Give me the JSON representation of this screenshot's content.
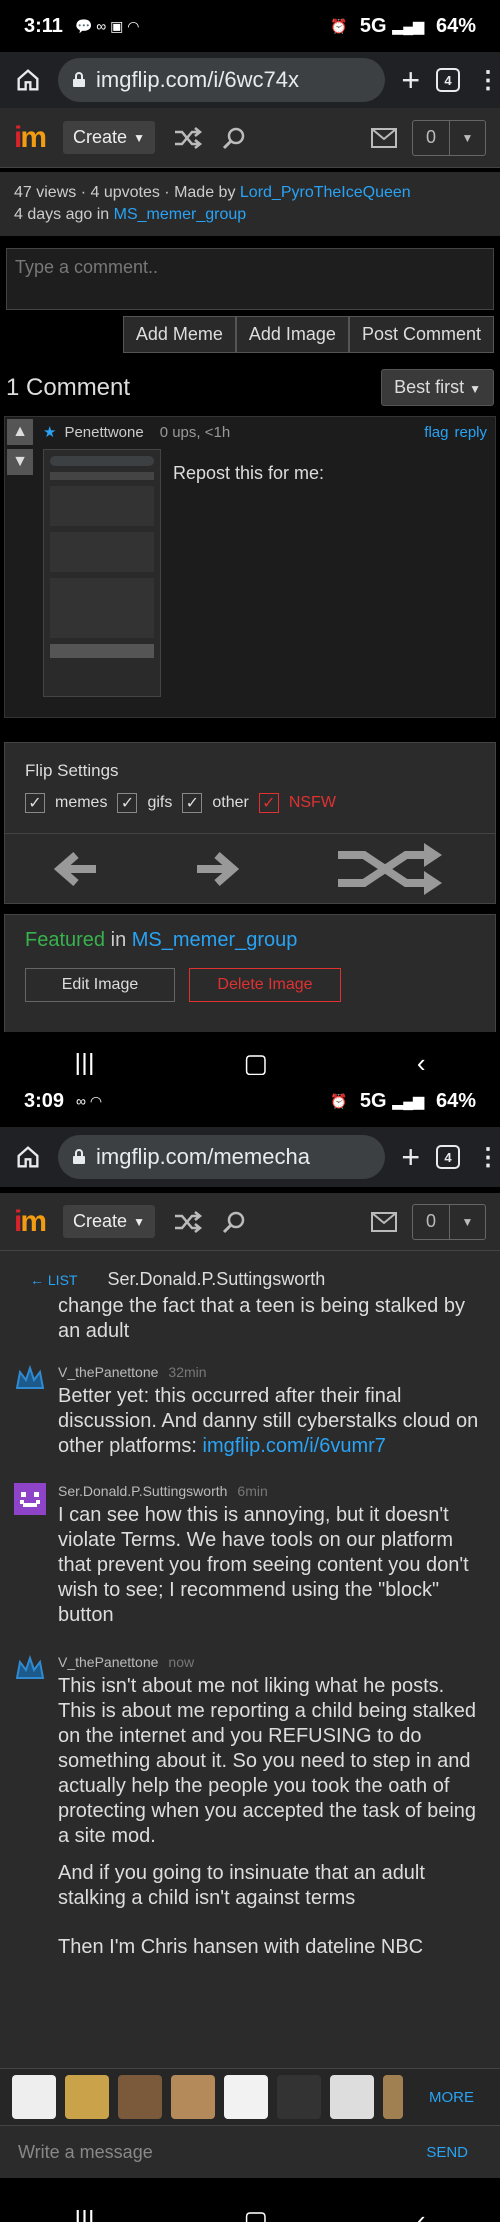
{
  "screen1": {
    "status": {
      "time": "3:11",
      "network": "5G",
      "battery": "64%"
    },
    "url": "imgflip.com/i/6wc74x",
    "tab_count": "4",
    "nav": {
      "create_label": "Create",
      "counter": "0"
    },
    "meta": {
      "views": "47 views",
      "upvotes": "4 upvotes",
      "made_by_prefix": "Made by",
      "author": "Lord_PyroTheIceQueen",
      "age": "4 days ago in",
      "stream": "MS_memer_group"
    },
    "comment_placeholder": "Type a comment..",
    "buttons": {
      "add_meme": "Add Meme",
      "add_image": "Add Image",
      "post_comment": "Post Comment"
    },
    "comments_count": "1 Comment",
    "sort_label": "Best first",
    "comment": {
      "user": "Penettwone",
      "stats": "0 ups, <1h",
      "flag": "flag",
      "reply": "reply",
      "text": "Repost this for me:"
    },
    "flip": {
      "title": "Flip Settings",
      "options": [
        "memes",
        "gifs",
        "other",
        "NSFW"
      ]
    },
    "featured": {
      "label": "Featured",
      "in": "in",
      "stream": "MS_memer_group"
    },
    "edit_image": "Edit Image",
    "delete_image": "Delete Image"
  },
  "screen2": {
    "status": {
      "time": "3:09",
      "network": "5G",
      "battery": "64%"
    },
    "url": "imgflip.com/memecha",
    "tab_count": "4",
    "nav": {
      "create_label": "Create",
      "counter": "0"
    },
    "chat_header": {
      "back": "← LIST",
      "title": "Ser.Donald.P.Suttingsworth"
    },
    "truncated_text": "change the fact that a teen is being stalked by an adult",
    "messages": [
      {
        "user": "V_thePanettone",
        "time": "32min",
        "text": "Better yet: this occurred after their final discussion. And danny still cyberstalks cloud on other platforms: ",
        "link": "imgflip.com/i/6vumr7"
      },
      {
        "user": "Ser.Donald.P.Suttingsworth",
        "time": "6min",
        "text": "I can see how this is annoying, but it doesn't violate Terms. We have tools on our platform that prevent you from seeing content you don't wish to see; I recommend using the \"block\" button"
      },
      {
        "user": "V_thePanettone",
        "time": "now",
        "text": "This isn't about me not liking what he posts. This is about me reporting a child being stalked on the internet and you REFUSING to do something about it. So you need to step in and actually help the people you took the oath of protecting when you accepted the task of being a site mod.",
        "text2": "And if you going to insinuate that an adult stalking a child isn't against terms",
        "text3": "Then I'm Chris hansen with dateline NBC"
      }
    ],
    "more_label": "MORE",
    "message_placeholder": "Write a message",
    "send_label": "SEND"
  },
  "colors": {
    "accent_blue": "#29a3f5",
    "featured_green": "#37b24d",
    "nsfw_red": "#e03131",
    "brand_red": "#d8232a"
  }
}
